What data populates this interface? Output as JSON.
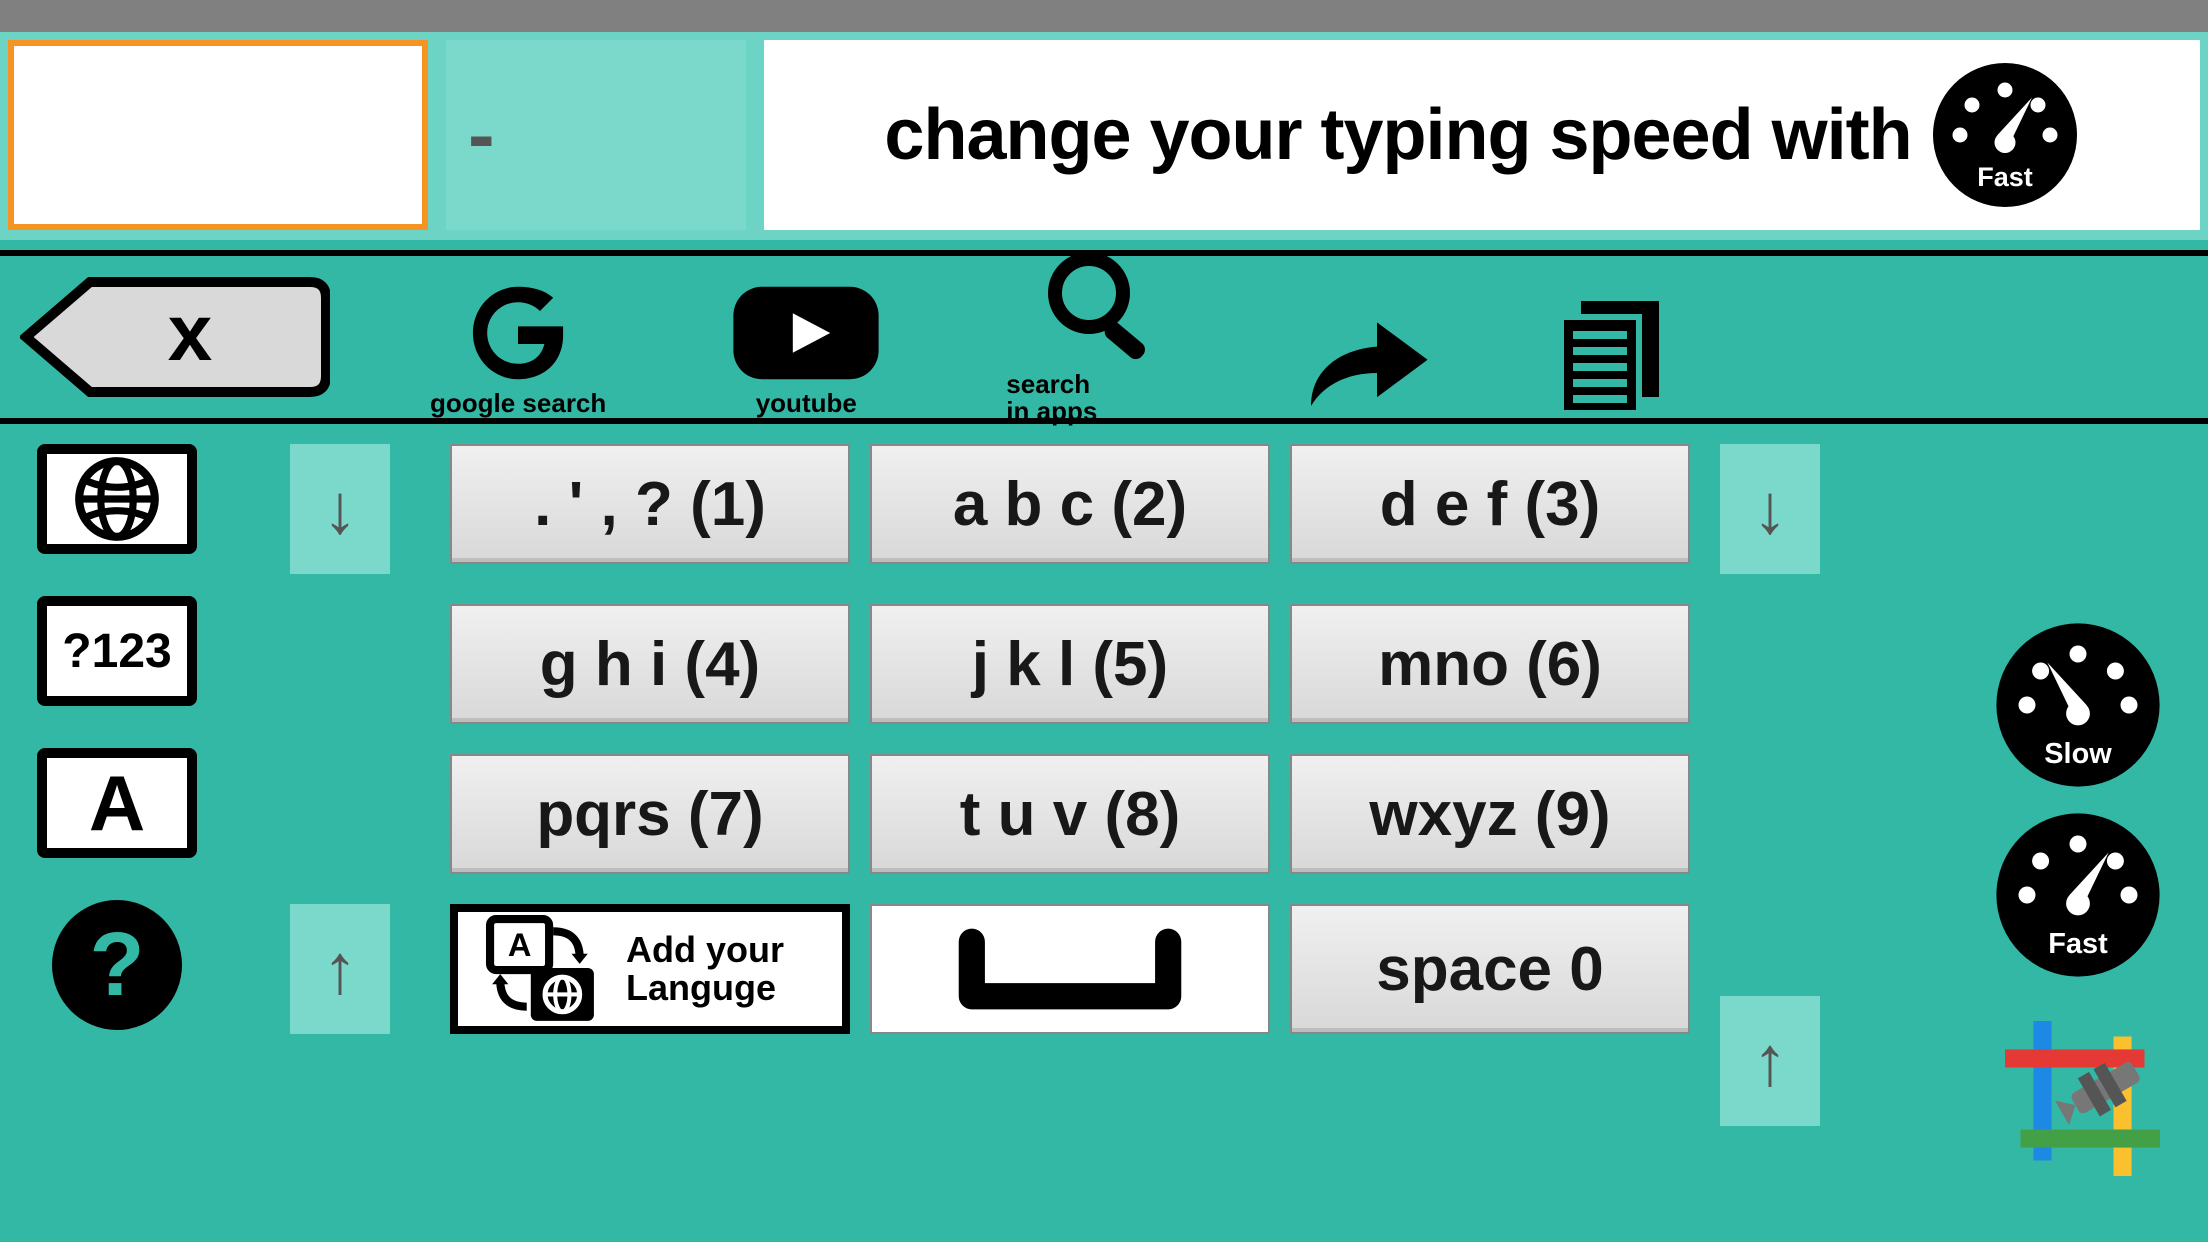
{
  "header": {
    "main_input_value": "",
    "secondary_input_value": "-",
    "hint_text": "change your typing speed with",
    "hint_gauge_label": "Fast"
  },
  "toolbar": {
    "backspace_symbol": "x",
    "google_label": "google search",
    "youtube_label": "youtube",
    "search_apps_label": "search\nin apps"
  },
  "left_sidebar": {
    "globe_label": "",
    "numeric_label": "?123",
    "caps_label": "A",
    "help_label": "?"
  },
  "arrows": {
    "down": "↓",
    "up": "↑"
  },
  "keypad": {
    "r1c1": ". ' , ? (1)",
    "r1c2": "a b c (2)",
    "r1c3": "d e f (3)",
    "r2c1": "g h i (4)",
    "r2c2": "j k l (5)",
    "r2c3": "mno (6)",
    "r3c1": "pqrs (7)",
    "r3c2": "t u v (8)",
    "r3c3": "wxyz (9)",
    "r4c3": "space 0",
    "add_language_label": "Add your\nLanguge"
  },
  "right_sidebar": {
    "slow_label": "Slow",
    "fast_label": "Fast"
  }
}
